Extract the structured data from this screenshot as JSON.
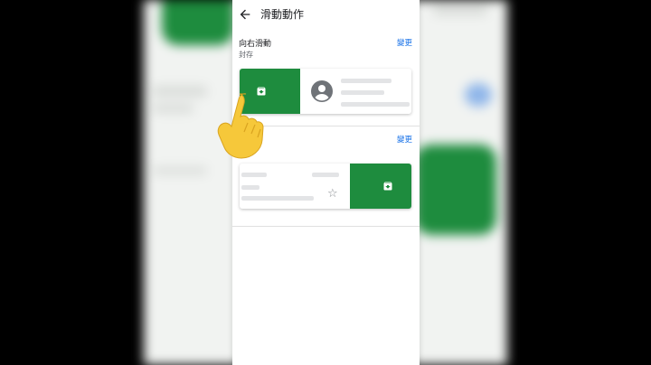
{
  "header": {
    "title": "滑動動作",
    "back_icon": "arrow-back-icon"
  },
  "right_swipe": {
    "title": "向右滑動",
    "action": "封存",
    "change_label": "變更"
  },
  "left_swipe": {
    "title": "向左滑動",
    "title_visible": "動",
    "change_label": "變更"
  },
  "colors": {
    "swipe_green": "#1e8c3e",
    "link_blue": "#1a73e8"
  },
  "icons": [
    "arrow-back-icon",
    "archive-icon",
    "avatar-icon",
    "star-icon",
    "pointing-hand-icon"
  ]
}
